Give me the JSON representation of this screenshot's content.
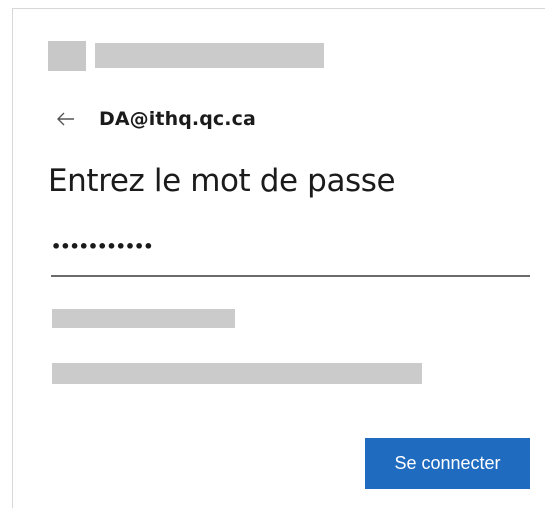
{
  "header": {
    "logo_icon": "microsoft-logo-redacted"
  },
  "identity": {
    "back_icon": "arrow-left-icon",
    "email": "DA@ithq.qc.ca"
  },
  "form": {
    "title": "Entrez le mot de passe",
    "password_value": "•••••••••••",
    "submit_label": "Se connecter"
  },
  "colors": {
    "accent": "#1f6bbf",
    "redaction": "#cbcbcb"
  }
}
